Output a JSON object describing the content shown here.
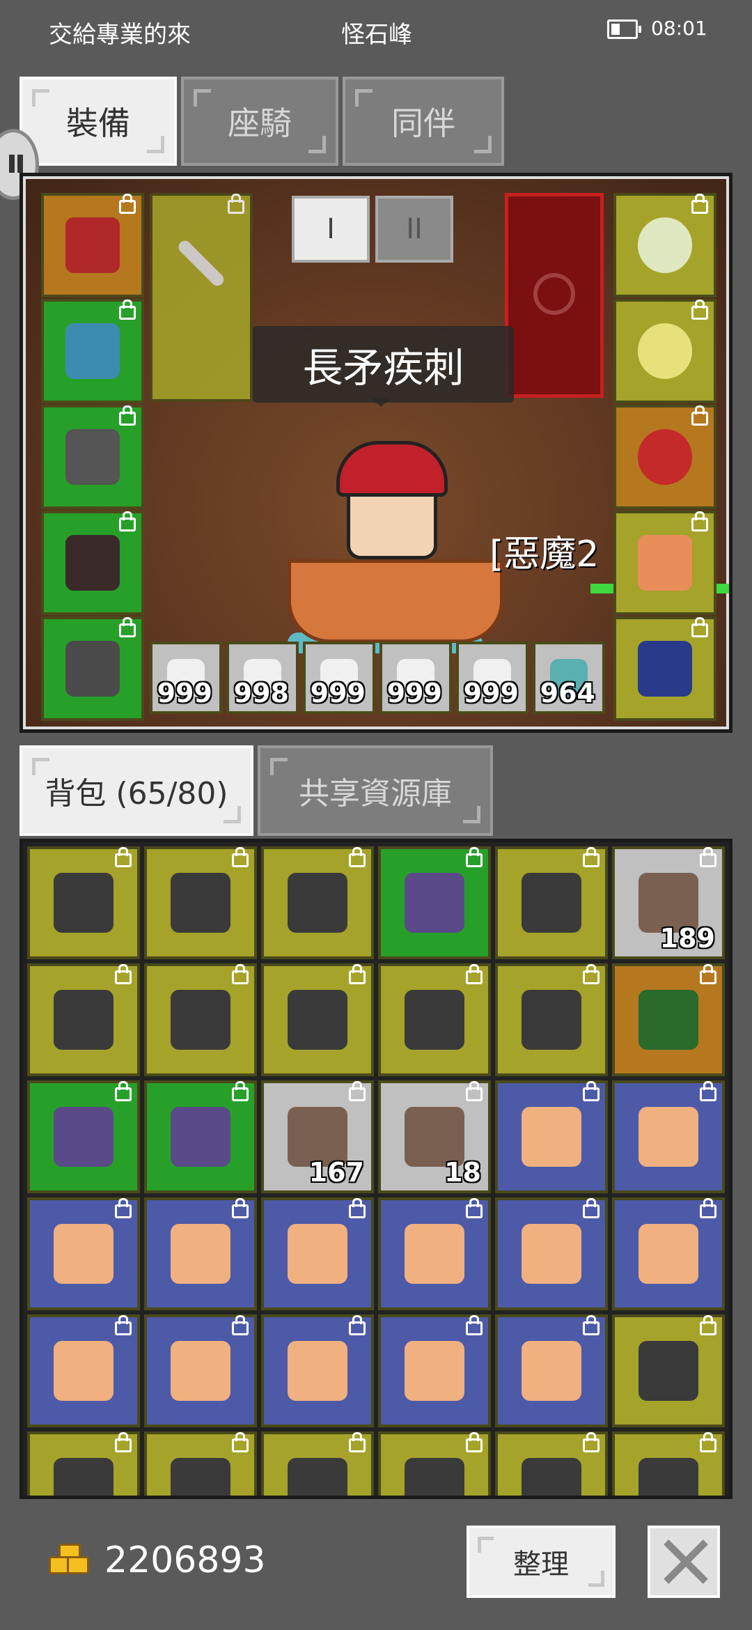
{
  "status": {
    "left_text": "交給專業的來",
    "center_text": "怪石峰",
    "time": "08:01"
  },
  "tabs_top": [
    {
      "label": "裝備",
      "active": true
    },
    {
      "label": "座騎",
      "active": false
    },
    {
      "label": "同伴",
      "active": false
    }
  ],
  "equip": {
    "toggle_1": "I",
    "toggle_2": "II",
    "skill_tooltip": "長矛疾刺",
    "player_name_partial": "[惡魔2",
    "consumables": [
      {
        "name": "potion-icon",
        "qty": "999"
      },
      {
        "name": "potion-icon",
        "qty": "998"
      },
      {
        "name": "potion-icon",
        "qty": "999"
      },
      {
        "name": "potion-icon",
        "qty": "999"
      },
      {
        "name": "potion-icon",
        "qty": "999"
      },
      {
        "name": "fish-icon",
        "qty": "964"
      }
    ]
  },
  "tabs_bag": [
    {
      "label": "背包 (65/80)",
      "active": true
    },
    {
      "label": "共享資源庫",
      "active": false
    }
  ],
  "bag": {
    "rows": [
      [
        {
          "c": "olive",
          "q": ""
        },
        {
          "c": "olive",
          "q": ""
        },
        {
          "c": "olive",
          "q": ""
        },
        {
          "c": "green",
          "q": ""
        },
        {
          "c": "olive",
          "q": ""
        },
        {
          "c": "gray",
          "q": "189"
        }
      ],
      [
        {
          "c": "olive",
          "q": ""
        },
        {
          "c": "olive",
          "q": ""
        },
        {
          "c": "olive",
          "q": ""
        },
        {
          "c": "olive",
          "q": ""
        },
        {
          "c": "olive",
          "q": ""
        },
        {
          "c": "orange",
          "q": ""
        }
      ],
      [
        {
          "c": "green",
          "q": ""
        },
        {
          "c": "green",
          "q": ""
        },
        {
          "c": "gray",
          "q": "167"
        },
        {
          "c": "gray",
          "q": "18"
        },
        {
          "c": "blue",
          "q": ""
        },
        {
          "c": "blue",
          "q": ""
        }
      ],
      [
        {
          "c": "blue",
          "q": ""
        },
        {
          "c": "blue",
          "q": ""
        },
        {
          "c": "blue",
          "q": ""
        },
        {
          "c": "blue",
          "q": ""
        },
        {
          "c": "blue",
          "q": ""
        },
        {
          "c": "blue",
          "q": ""
        }
      ],
      [
        {
          "c": "blue",
          "q": ""
        },
        {
          "c": "blue",
          "q": ""
        },
        {
          "c": "blue",
          "q": ""
        },
        {
          "c": "blue",
          "q": ""
        },
        {
          "c": "blue",
          "q": ""
        },
        {
          "c": "olive",
          "q": ""
        }
      ],
      [
        {
          "c": "olive",
          "q": ""
        },
        {
          "c": "olive",
          "q": ""
        },
        {
          "c": "olive",
          "q": ""
        },
        {
          "c": "olive",
          "q": ""
        },
        {
          "c": "olive",
          "q": ""
        },
        {
          "c": "olive",
          "q": ""
        }
      ]
    ]
  },
  "footer": {
    "gold": "2206893",
    "sort_label": "整理"
  }
}
